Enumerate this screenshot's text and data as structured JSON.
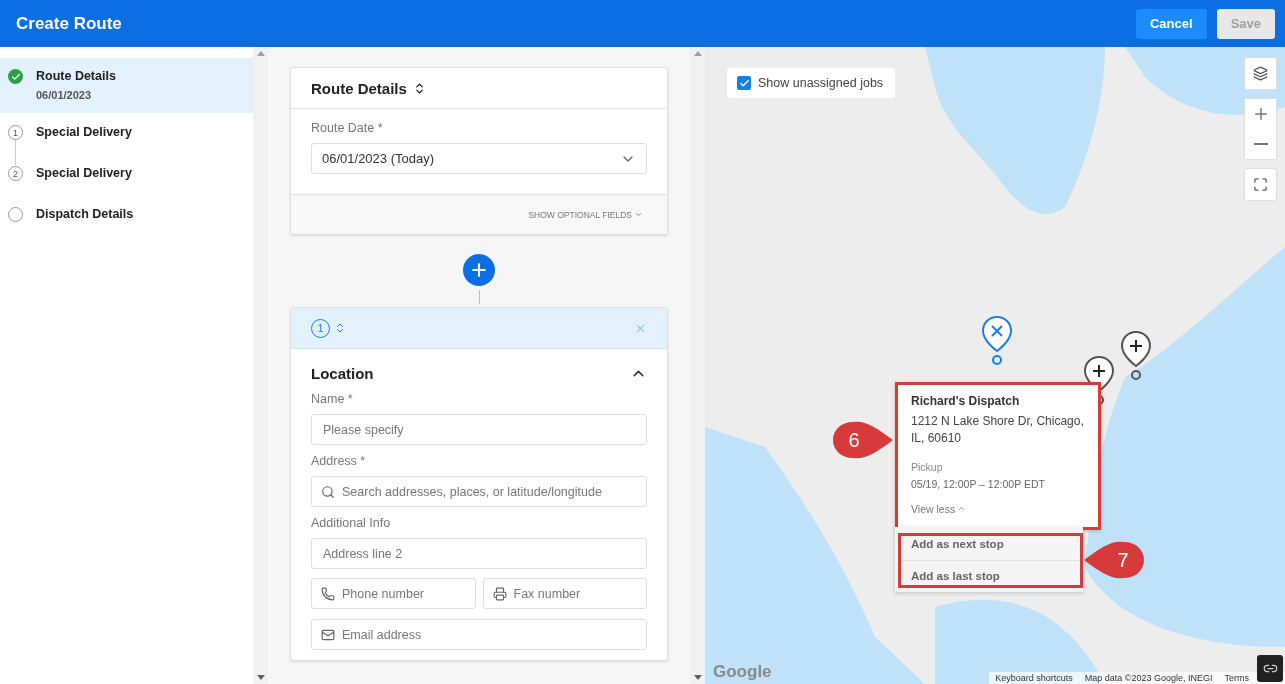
{
  "header": {
    "title": "Create Route",
    "buttons": [
      {
        "label": "Cancel",
        "disabled": false
      },
      {
        "label": "Save",
        "disabled": true
      }
    ]
  },
  "steps": [
    {
      "title": "Route Details",
      "subtitle": "06/01/2023",
      "completed": true,
      "selected": true
    },
    {
      "title": "Special Delivery",
      "number": "1",
      "completed": false,
      "selected": false
    },
    {
      "title": "Special Delivery",
      "number": "2",
      "completed": false,
      "selected": false
    },
    {
      "title": "Dispatch Details",
      "completed": false,
      "selected": false
    }
  ],
  "route_card": {
    "title": "Route Details",
    "date_label": "Route Date *",
    "date_value": "06/01/2023 (Today)",
    "optional_link": "SHOW OPTIONAL FIELDS"
  },
  "stop_card": {
    "number": "1",
    "section_title": "Location",
    "expanded": true,
    "rows": [
      {
        "label": "Name *",
        "inputs": [
          {
            "placeholder": "Please specify",
            "kind": "text"
          }
        ]
      },
      {
        "label": "Address *",
        "inputs": [
          {
            "placeholder": "Search addresses, places, or latitude/longitude",
            "kind": "search"
          }
        ]
      },
      {
        "label": "Additional Info",
        "inputs": [
          {
            "placeholder": "Address line 2",
            "kind": "text"
          }
        ]
      },
      {
        "inputs": [
          {
            "placeholder": "Phone number",
            "kind": "phone"
          },
          {
            "placeholder": "Fax number",
            "kind": "fax"
          }
        ]
      },
      {
        "inputs": [
          {
            "placeholder": "Email address",
            "kind": "email"
          }
        ]
      }
    ]
  },
  "map": {
    "unassigned": {
      "label": "Show unassigned jobs",
      "checked": true
    },
    "popup": {
      "name": "Richard's Dispatch",
      "address": "1212 N Lake Shore Dr, Chicago, IL, 60610",
      "type": "Pickup",
      "time": "05/19, 12:00P – 12:00P EDT",
      "toggle": "View less"
    },
    "actions": [
      "Add as next stop",
      "Add as last stop"
    ],
    "callouts": [
      "6",
      "7"
    ],
    "logo": "Google",
    "footer_links": [
      "Keyboard shortcuts",
      "Map data ©2023 Google, INEGI",
      "Terms"
    ]
  }
}
